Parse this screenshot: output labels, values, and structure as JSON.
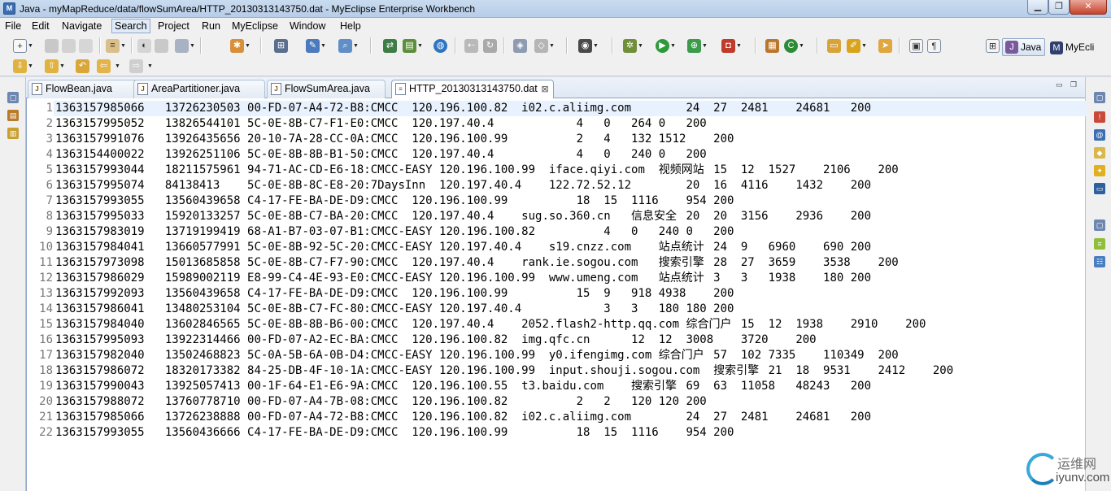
{
  "window": {
    "title": "Java - myMapReduce/data/flowSumArea/HTTP_20130313143750.dat - MyEclipse Enterprise Workbench",
    "min_glyph": "▁",
    "max_glyph": "❐",
    "close_glyph": "✕"
  },
  "menu": {
    "items": [
      "File",
      "Edit",
      "Navigate",
      "Search",
      "Project",
      "Run",
      "MyEclipse",
      "Window",
      "Help"
    ],
    "active": "Search"
  },
  "perspectives": {
    "java_label": "Java",
    "myeclipse_label": "MyEcli"
  },
  "tabs": [
    {
      "label": "FlowBean.java",
      "active": false
    },
    {
      "label": "AreaPartitioner.java",
      "active": false
    },
    {
      "label": "FlowSumArea.java",
      "active": false
    },
    {
      "label": "HTTP_20130313143750.dat",
      "active": true,
      "close": "⊠"
    }
  ],
  "lines": [
    {
      "n": "1",
      "t": "1363157985066\t13726230503\t00-FD-07-A4-72-B8:CMCC\t120.196.100.82\ti02.c.aliimg.com\t\t24\t27\t2481\t24681\t200"
    },
    {
      "n": "2",
      "t": "1363157995052\t13826544101\t5C-0E-8B-C7-F1-E0:CMCC\t120.197.40.4\t\t\t4\t0\t264\t0\t200"
    },
    {
      "n": "3",
      "t": "1363157991076\t13926435656\t20-10-7A-28-CC-0A:CMCC\t120.196.100.99\t\t\t2\t4\t132\t1512\t200"
    },
    {
      "n": "4",
      "t": "1363154400022\t13926251106\t5C-0E-8B-8B-B1-50:CMCC\t120.197.40.4\t\t\t4\t0\t240\t0\t200"
    },
    {
      "n": "5",
      "t": "1363157993044\t18211575961\t94-71-AC-CD-E6-18:CMCC-EASY\t120.196.100.99\tiface.qiyi.com\t视频网站\t15\t12\t1527\t2106\t200"
    },
    {
      "n": "6",
      "t": "1363157995074\t84138413\t5C-0E-8B-8C-E8-20:7DaysInn\t120.197.40.4\t122.72.52.12\t\t20\t16\t4116\t1432\t200"
    },
    {
      "n": "7",
      "t": "1363157993055\t13560439658\tC4-17-FE-BA-DE-D9:CMCC\t120.196.100.99\t\t\t18\t15\t1116\t954\t200"
    },
    {
      "n": "8",
      "t": "1363157995033\t15920133257\t5C-0E-8B-C7-BA-20:CMCC\t120.197.40.4\tsug.so.360.cn\t信息安全\t20\t20\t3156\t2936\t200"
    },
    {
      "n": "9",
      "t": "1363157983019\t13719199419\t68-A1-B7-03-07-B1:CMCC-EASY\t120.196.100.82\t\t\t4\t0\t240\t0\t200"
    },
    {
      "n": "10",
      "t": "1363157984041\t13660577991\t5C-0E-8B-92-5C-20:CMCC-EASY\t120.197.40.4\ts19.cnzz.com\t站点统计\t24\t9\t6960\t690\t200"
    },
    {
      "n": "11",
      "t": "1363157973098\t15013685858\t5C-0E-8B-C7-F7-90:CMCC\t120.197.40.4\trank.ie.sogou.com\t搜索引擎\t28\t27\t3659\t3538\t200"
    },
    {
      "n": "12",
      "t": "1363157986029\t15989002119\tE8-99-C4-4E-93-E0:CMCC-EASY\t120.196.100.99\twww.umeng.com\t站点统计\t3\t3\t1938\t180\t200"
    },
    {
      "n": "13",
      "t": "1363157992093\t13560439658\tC4-17-FE-BA-DE-D9:CMCC\t120.196.100.99\t\t\t15\t9\t918\t4938\t200"
    },
    {
      "n": "14",
      "t": "1363157986041\t13480253104\t5C-0E-8B-C7-FC-80:CMCC-EASY\t120.197.40.4\t\t\t3\t3\t180\t180\t200"
    },
    {
      "n": "15",
      "t": "1363157984040\t13602846565\t5C-0E-8B-8B-B6-00:CMCC\t120.197.40.4\t2052.flash2-http.qq.com\t综合门户\t15\t12\t1938\t2910\t200"
    },
    {
      "n": "16",
      "t": "1363157995093\t13922314466\t00-FD-07-A2-EC-BA:CMCC\t120.196.100.82\timg.qfc.cn\t\t12\t12\t3008\t3720\t200"
    },
    {
      "n": "17",
      "t": "1363157982040\t13502468823\t5C-0A-5B-6A-0B-D4:CMCC-EASY\t120.196.100.99\ty0.ifengimg.com\t综合门户\t57\t102\t7335\t110349\t200"
    },
    {
      "n": "18",
      "t": "1363157986072\t18320173382\t84-25-DB-4F-10-1A:CMCC-EASY\t120.196.100.99\tinput.shouji.sogou.com\t搜索引擎\t21\t18\t9531\t2412\t200"
    },
    {
      "n": "19",
      "t": "1363157990043\t13925057413\t00-1F-64-E1-E6-9A:CMCC\t120.196.100.55\tt3.baidu.com\t搜索引擎\t69\t63\t11058\t48243\t200"
    },
    {
      "n": "20",
      "t": "1363157988072\t13760778710\t00-FD-07-A4-7B-08:CMCC\t120.196.100.82\t\t\t2\t2\t120\t120\t200"
    },
    {
      "n": "21",
      "t": "1363157985066\t13726238888\t00-FD-07-A4-72-B8:CMCC\t120.196.100.82\ti02.c.aliimg.com\t\t24\t27\t2481\t24681\t200"
    },
    {
      "n": "22",
      "t": "1363157993055\t13560436666\tC4-17-FE-BA-DE-D9:CMCC\t120.196.100.99\t\t\t18\t15\t1116\t954\t200"
    }
  ],
  "watermark": {
    "cn": "运维网",
    "en": "iyunv.com"
  },
  "colors": {
    "current_line": "#e8f2fe",
    "line_number": "#787878"
  }
}
